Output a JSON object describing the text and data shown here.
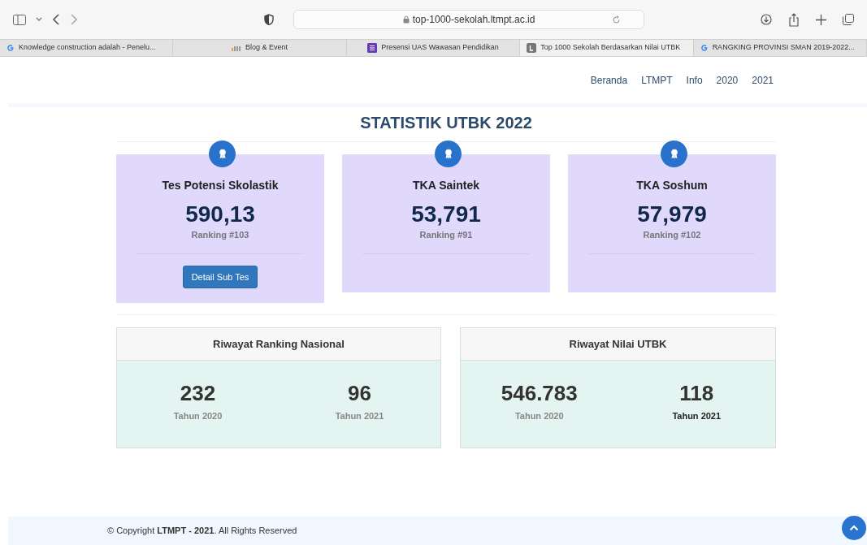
{
  "browser": {
    "url": "top-1000-sekolah.ltmpt.ac.id",
    "tabs": [
      {
        "title": "Knowledge construction adalah - Penelu...",
        "kind": "google",
        "selected": false
      },
      {
        "title": "Blog & Event",
        "kind": "bars",
        "selected": false
      },
      {
        "title": "Presensi UAS Wawasan Pendidikan",
        "kind": "form",
        "selected": false
      },
      {
        "title": "Top 1000 Sekolah Berdasarkan Nilai UTBK",
        "kind": "letter",
        "selected": true
      },
      {
        "title": "RANGKING PROVINSI SMAN 2019-2022...",
        "kind": "google",
        "selected": false
      }
    ]
  },
  "nav": [
    "Beranda",
    "LTMPT",
    "Info",
    "2020",
    "2021"
  ],
  "title": "STATISTIK UTBK 2022",
  "score_cards": [
    {
      "title": "Tes Potensi Skolastik",
      "score": "590,13",
      "ranking": "Ranking #103",
      "button": "Detail Sub Tes"
    },
    {
      "title": "TKA Saintek",
      "score": "53,791",
      "ranking": "Ranking #91"
    },
    {
      "title": "TKA Soshum",
      "score": "57,979",
      "ranking": "Ranking #102"
    }
  ],
  "history": [
    {
      "title": "Riwayat Ranking Nasional",
      "entries": [
        {
          "value": "232",
          "label": "Tahun 2020",
          "emphasized": false
        },
        {
          "value": "96",
          "label": "Tahun 2021",
          "emphasized": false
        }
      ]
    },
    {
      "title": "Riwayat Nilai UTBK",
      "entries": [
        {
          "value": "546.783",
          "label": "Tahun 2020",
          "emphasized": false
        },
        {
          "value": "118",
          "label": "Tahun 2021",
          "emphasized": true
        }
      ]
    }
  ],
  "footer": "© Copyright **LTMPT - 2021**. All Rights Reserved"
}
